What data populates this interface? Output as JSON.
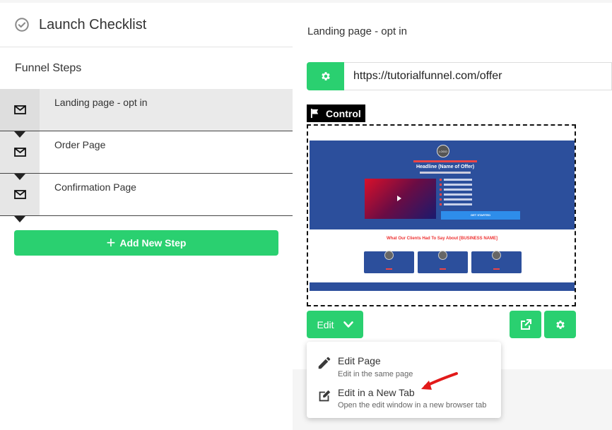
{
  "left_panel": {
    "checklist_title": "Launch Checklist",
    "funnel_steps_title": "Funnel Steps",
    "steps": [
      {
        "label": "Landing page - opt in",
        "icon": "envelope-icon",
        "active": true
      },
      {
        "label": "Order Page",
        "icon": "envelope-icon",
        "active": false
      },
      {
        "label": "Confirmation Page",
        "icon": "envelope-icon",
        "active": false
      }
    ],
    "add_step_label": "Add New Step"
  },
  "right_panel": {
    "page_title": "Landing page - opt in",
    "url": "https://tutorialfunnel.com/offer",
    "control_label": "Control",
    "preview": {
      "logo": "LOGO",
      "headline": "Headline (Name of Offer)",
      "cta": "GET STARTED",
      "testimonials_title": "What Our Clients Had To Say About [BUSINESS NAME]"
    },
    "edit_label": "Edit",
    "dropdown": [
      {
        "label": "Edit Page",
        "description": "Edit in the same page",
        "icon": "pencil-icon"
      },
      {
        "label": "Edit in a New Tab",
        "description": "Open the edit window in a new browser tab",
        "icon": "edit-note-icon"
      }
    ]
  },
  "colors": {
    "accent": "#2ad070",
    "annotation_arrow": "#e21a1a",
    "preview_blue": "#2c4f9c"
  }
}
